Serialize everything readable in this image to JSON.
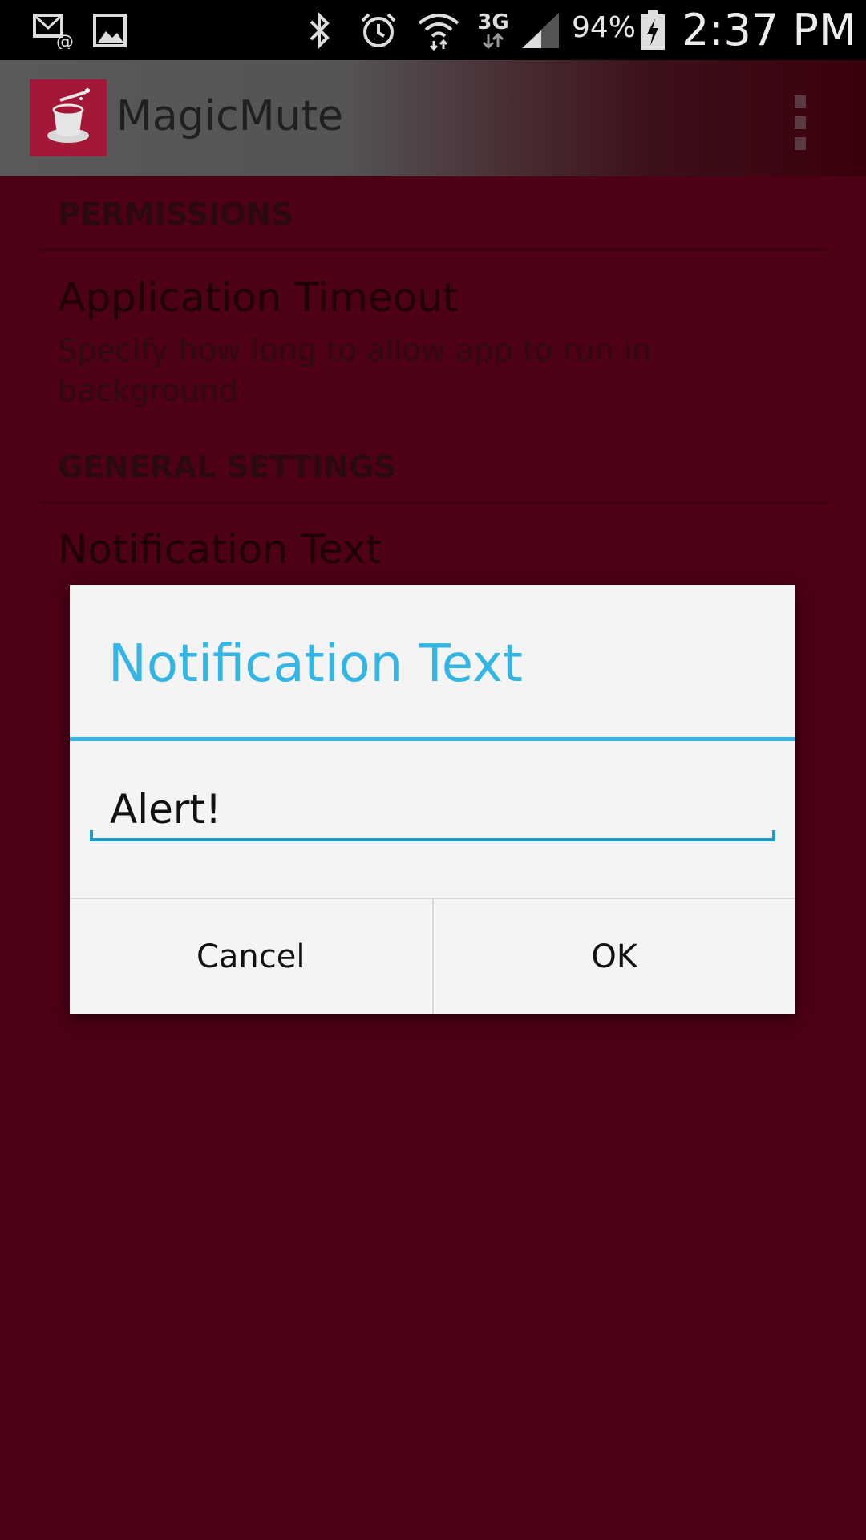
{
  "status_bar": {
    "battery_percent": "94%",
    "clock": "2:37 PM",
    "network_type": "3G",
    "icons": [
      "email-notification-icon",
      "gallery-notification-icon",
      "bluetooth-icon",
      "alarm-icon",
      "wifi-icon",
      "signal-3g-icon",
      "cell-signal-icon",
      "battery-charging-icon"
    ]
  },
  "app_bar": {
    "title": "MagicMute",
    "logo_icon": "magic-hat-icon",
    "menu_icon": "overflow-menu-icon"
  },
  "preferences": {
    "sections": [
      {
        "header": "PERMISSIONS",
        "items": [
          {
            "title": "Application Timeout",
            "summary": "Specify how long to allow app to run in background"
          }
        ]
      },
      {
        "header": "GENERAL SETTINGS",
        "items": [
          {
            "title": "Notification Text",
            "summary": ""
          }
        ]
      }
    ]
  },
  "dialog": {
    "title": "Notification Text",
    "input_value": "Alert!",
    "cancel_label": "Cancel",
    "ok_label": "OK"
  },
  "colors": {
    "background": "#4e0015",
    "accent": "#33b5e5",
    "logo_bg": "#a31837",
    "dialog_bg": "#f4f4f4"
  }
}
